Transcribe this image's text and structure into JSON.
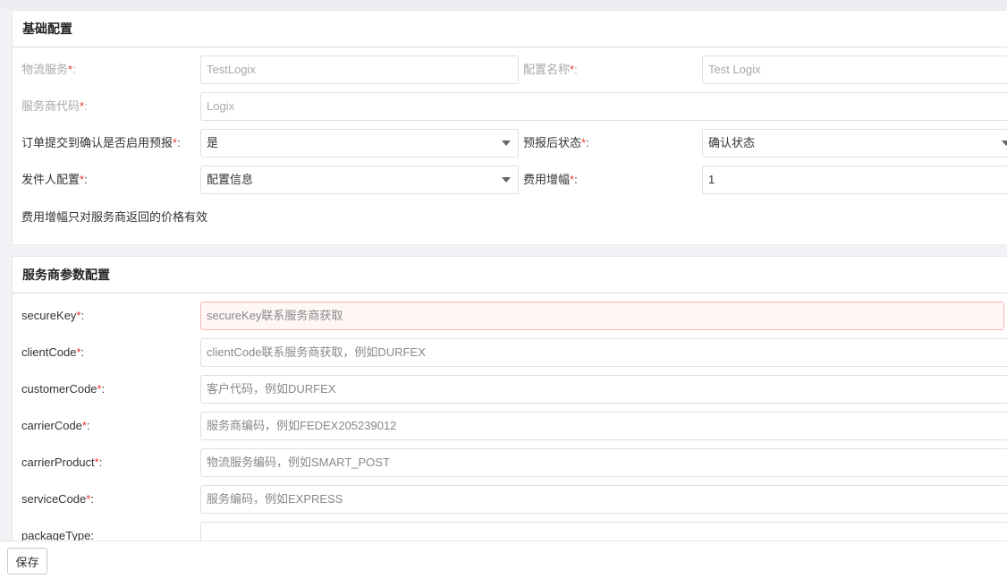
{
  "basic": {
    "title": "基础配置",
    "logistics_service_label": "物流服务",
    "logistics_service_value": "TestLogix",
    "config_name_label": "配置名称",
    "config_name_value": "Test Logix",
    "provider_code_label": "服务商代码",
    "provider_code_value": "Logix",
    "prereport_label": "订单提交到确认是否启用预报",
    "prereport_value": "是",
    "after_status_label": "预报后状态",
    "after_status_value": "确认状态",
    "sender_label": "发件人配置",
    "sender_value": "配置信息",
    "fee_label": "费用增幅",
    "fee_value": "1",
    "note": "费用增幅只对服务商返回的价格有效",
    "required_mark": "*",
    "colon": ":"
  },
  "provider": {
    "title": "服务商参数配置",
    "fields": [
      {
        "label": "secureKey",
        "placeholder": "secureKey联系服务商获取"
      },
      {
        "label": "clientCode",
        "placeholder": "clientCode联系服务商获取，例如DURFEX"
      },
      {
        "label": "customerCode",
        "placeholder": "客户代码，例如DURFEX"
      },
      {
        "label": "carrierCode",
        "placeholder": "服务商编码，例如FEDEX205239012"
      },
      {
        "label": "carrierProduct",
        "placeholder": "物流服务编码，例如SMART_POST"
      },
      {
        "label": "serviceCode",
        "placeholder": "服务编码，例如EXPRESS"
      },
      {
        "label": "packageType",
        "placeholder": ""
      }
    ]
  },
  "footer": {
    "save_label": "保存"
  }
}
